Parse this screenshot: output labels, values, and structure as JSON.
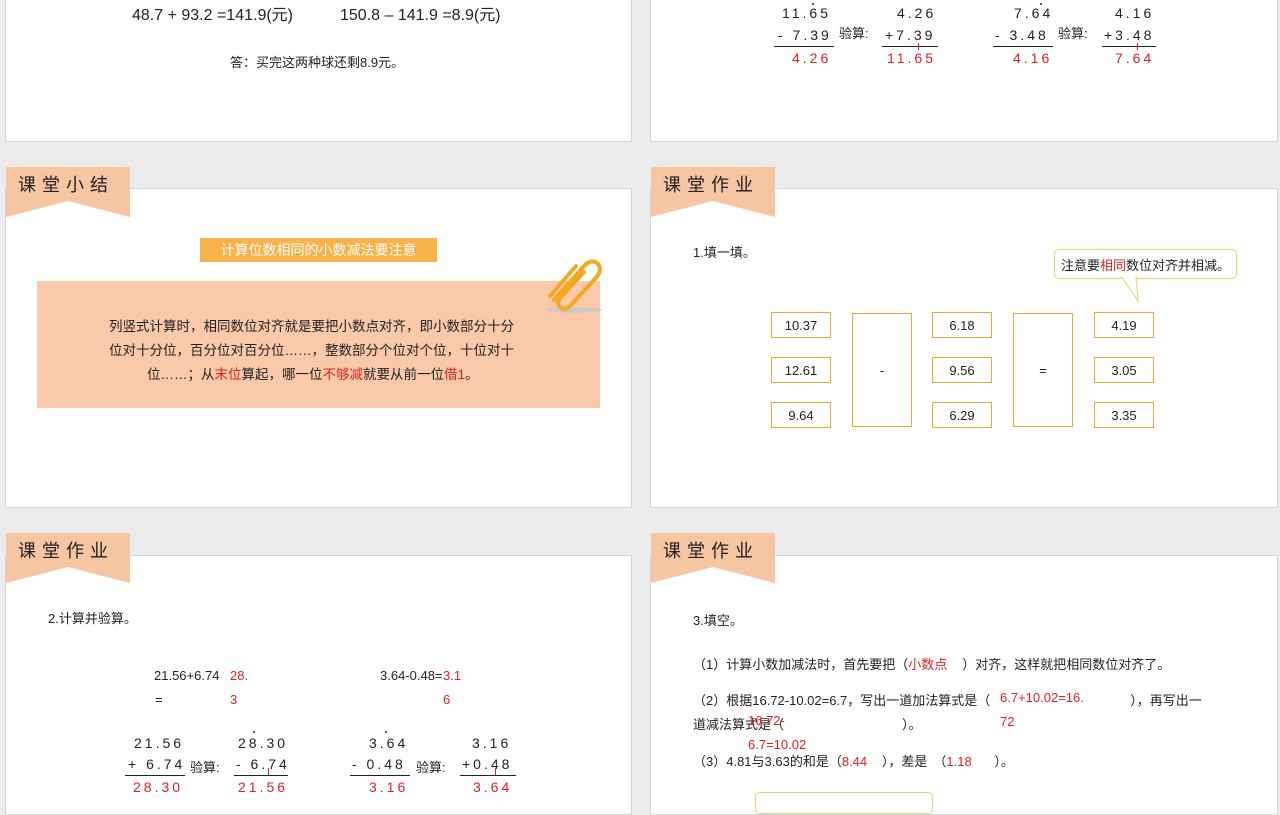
{
  "slide1": {
    "eq1": "48.7 + 93.2 =141.9(元)",
    "eq2": "150.8 – 141.9 =8.9(元)",
    "answer": "答：买完这两种球还剩8.9元。"
  },
  "slide2": {
    "a_top": "11.65",
    "a_sub": "- 7.39",
    "a_result": "4.26",
    "verify_label": "验算:",
    "b_top": "4.26",
    "b_add": "+7.39",
    "b_result": "11.65",
    "c_top": "7.64",
    "c_sub": "- 3.48",
    "c_result": "4.16",
    "d_top": "4.16",
    "d_add": "+3.48",
    "d_result": "7.64"
  },
  "slide3": {
    "title": "课堂小结",
    "banner": "计算位数相同的小数减法要注意",
    "body_part1": "列竖式计算时，相同数位对齐就是要把小数点对齐，即小数部分十分",
    "body_part2": "位对十分位，百分位对百分位……，整数部分个位对个位，十位对十",
    "body_part3a": "位……；从",
    "body_hl1": "末位",
    "body_part3b": "算起，哪一位",
    "body_hl2": "不够减",
    "body_part3c": "就要从前一位",
    "body_hl3": "借1",
    "body_part3d": "。",
    "accent_color": "#f6c5a2",
    "icon": "paperclip-icon"
  },
  "slide4": {
    "title": "课堂作业",
    "question": "1.填一填。",
    "tip_pre": "注意要",
    "tip_hl": "相同",
    "tip_post": "数位对齐并相减。",
    "col1": [
      "10.37",
      "12.61",
      "9.64"
    ],
    "minus": "-",
    "col2": [
      "6.18",
      "9.56",
      "6.29"
    ],
    "equals": "=",
    "col3": [
      "4.19",
      "3.05",
      "3.35"
    ]
  },
  "slide5": {
    "title": "课堂作业",
    "question": "2.计算并验算。",
    "p1": "21.56+6.74",
    "p1_eq": "=",
    "p1_ans_a": "28.",
    "p1_ans_b": "3",
    "p2": "3.64-0.48=",
    "p2_ans_a": "3.1",
    "p2_ans_b": "6",
    "verify_label": "验算:",
    "a_top": "21.56",
    "a_add": "+ 6.74",
    "a_result": "28.30",
    "b_top": "28.30",
    "b_sub": "- 6.74",
    "b_result": "21.56",
    "c_top": "3.64",
    "c_sub": "- 0.48",
    "c_result": "3.16",
    "d_top": "3.16",
    "d_add": "+0.48",
    "d_result": "3.64"
  },
  "slide6": {
    "title": "课堂作业",
    "question": "3.填空。",
    "q1_pre": "（1）计算小数加减法时，首先要把（",
    "q1_ans": "小数点",
    "q1_post": "）对齐，这样就把相同数位对齐了。",
    "q2_pre": "（2）根据16.72-10.02=6.7，写出一道加法算式是（",
    "q2_ans_a": "6.7+10.02=16.",
    "q2_ans_b": "72",
    "q2_mid": "），再写出一",
    "q2_line2": "道减法算式是（",
    "q2_line2_end": "）。",
    "q2_ans2_a": "16.72-",
    "q2_ans2_b": "6.7=10.02",
    "q3_pre": "（3）4.81与3.63的和是（",
    "q3_ans1": "8.44",
    "q3_mid": "），差是",
    "q3_ans2": "1.18",
    "q3_post": "）。"
  }
}
